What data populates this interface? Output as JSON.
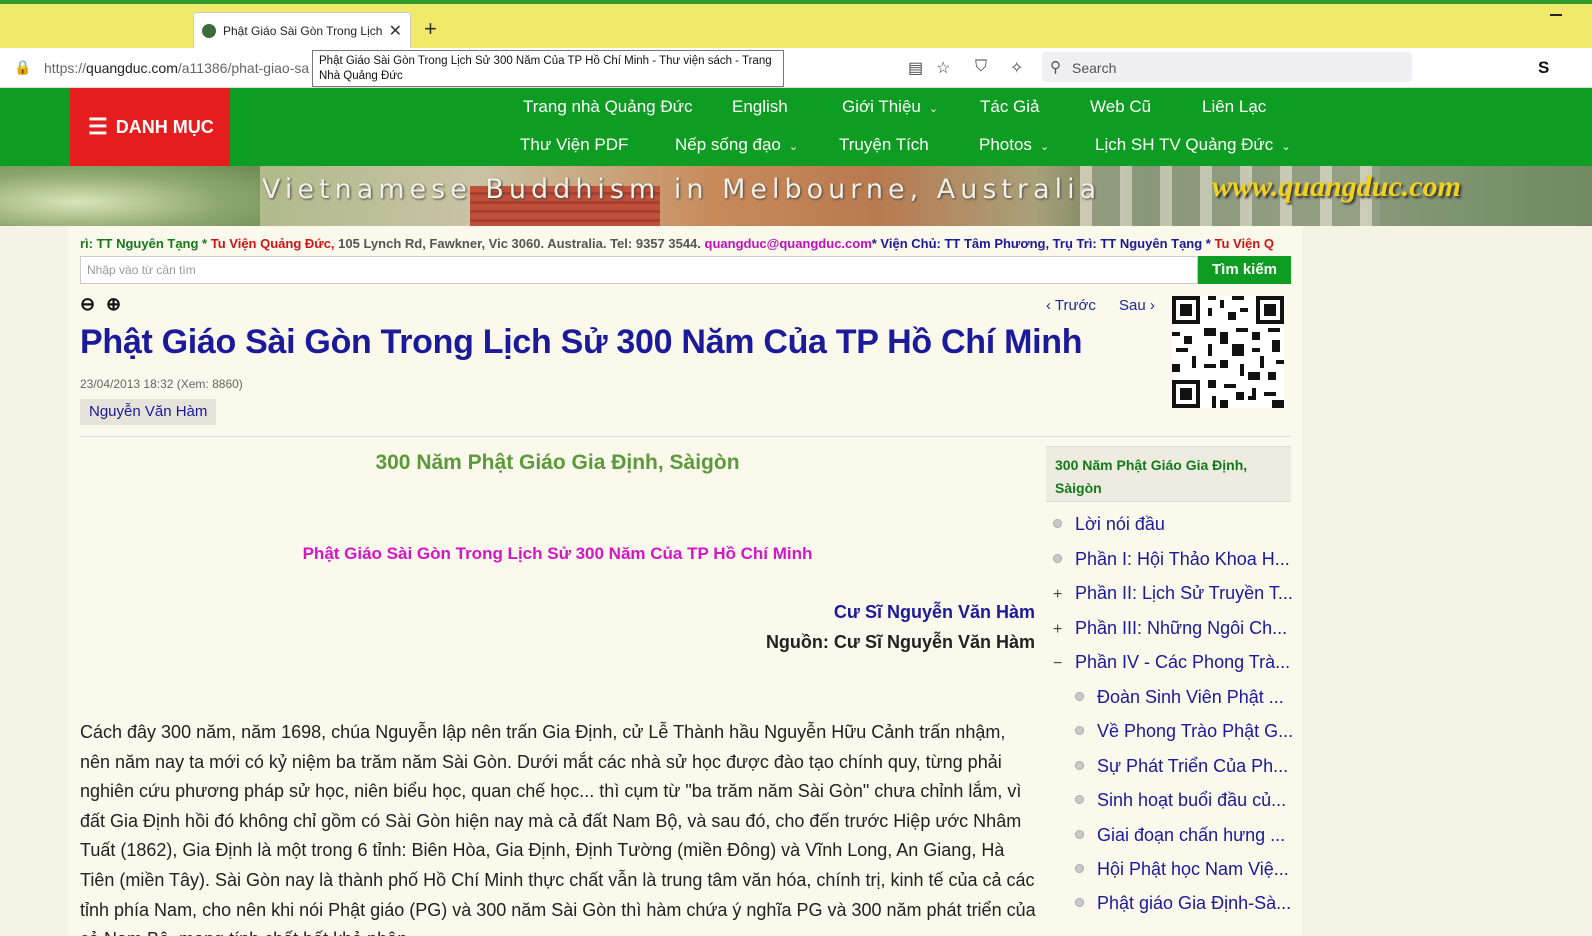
{
  "browser": {
    "tab_title": "Phật Giáo Sài Gòn Trong Lịch S",
    "url_prefix": "https://",
    "url_domain": "quangduc.com",
    "url_path": "/a11386/phat-giao-sa",
    "tooltip": "Phật Giáo Sài Gòn Trong Lịch Sử 300 Năm Của TP Hồ Chí Minh - Thư viện sách - Trang Nhà Quảng Đức",
    "search_placeholder": "Search",
    "new_tab": "+",
    "close_tab": "✕"
  },
  "header": {
    "danh_muc": "DANH MỤC",
    "menu_row1": [
      "Trang nhà Quảng Đức",
      "English",
      "Giới Thiệu",
      "Tác Giả",
      "Web Cũ",
      "Liên Lạc"
    ],
    "menu_row2": [
      "Thư Viện PDF",
      "Nếp sống đạo",
      "Truyện Tích",
      "Photos",
      "Lịch SH TV Quảng Đức"
    ],
    "banner_text": "Vietnamese Buddhism in Melbourne, Australia",
    "banner_url": "www.quangduc.com"
  },
  "ticker": {
    "t1": "rì: TT Nguyên Tạng *",
    "t2": "Tu Viện Quảng Đức,",
    "t3": "105 Lynch Rd, Fawkner, Vic 3060. Australia. Tel: 9357 3544.",
    "t4": "quangduc@quangduc.com",
    "t5": "* Viện Chủ: TT Tâm Phương, Trụ Trì: TT Nguyên Tạng *",
    "t6": "Tu Viện Q"
  },
  "site_search": {
    "placeholder": "Nhập vào từ cần tìm",
    "button": "Tìm kiếm"
  },
  "nav": {
    "zoom_out": "⊖",
    "zoom_in": "⊕",
    "prev": "Trước",
    "next": "Sau"
  },
  "article": {
    "title": "Phật Giáo Sài Gòn Trong Lịch Sử 300 Năm Của TP Hồ Chí Minh",
    "meta": "23/04/2013 18:32 (Xem: 8860)",
    "author_tag": "Nguyễn Văn Hàm",
    "sub1": "300 Năm Phật Giáo Gia Định, Sàigòn",
    "sub2": "Phật Giáo Sài Gòn Trong Lịch Sử 300 Năm Của TP Hồ Chí Minh",
    "byline1": "Cư Sĩ Nguyễn Văn Hàm",
    "byline2": "Nguồn: Cư Sĩ Nguyễn Văn Hàm",
    "body": "Cách đây 300 năm, năm 1698, chúa Nguyễn lập nên trấn Gia Định, cử Lễ Thành hầu Nguyễn Hữu Cảnh trấn nhậm, nên năm nay ta mới có kỷ niệm ba trăm năm Sài Gòn. Dưới mắt các nhà sử học được đào tạo chính quy, từng phải nghiên cứu phương pháp sử học, niên biểu học, quan chế học... thì cụm từ \"ba trăm năm Sài Gòn\" chưa chỉnh lắm, vì đất Gia Định hồi đó không chỉ gồm có Sài Gòn hiện nay mà cả đất Nam Bộ, và sau đó, cho đến trước Hiệp ước Nhâm Tuất (1862), Gia Định là một trong 6 tỉnh: Biên Hòa, Gia Định, Định Tường (miền Đông) và Vĩnh Long, An Giang, Hà Tiên (miền Tây). Sài Gòn nay là thành phố Hồ Chí Minh thực chất vẫn là trung tâm văn hóa, chính trị, kinh tế của cả các tỉnh phía Nam, cho nên khi nói Phật giáo (PG) và 300 năm Sài Gòn thì hàm chứa ý nghĩa PG và 300 năm phát triển của cả Nam Bộ, mang tính chất bất khả phân"
  },
  "sidebar": {
    "heading": "300 Năm Phật Giáo Gia Định, Sàigòn",
    "items": [
      {
        "label": "Lời nói đầu",
        "sign": ""
      },
      {
        "label": "Phần I: Hội Thảo Khoa H...",
        "sign": ""
      },
      {
        "label": "Phần II: Lịch Sử Truyền T...",
        "sign": "+"
      },
      {
        "label": "Phần III: Những Ngôi Ch...",
        "sign": "+"
      },
      {
        "label": "Phần IV - Các Phong Trà...",
        "sign": "−"
      }
    ],
    "subitems": [
      "Đoàn Sinh Viên Phật ...",
      "Về Phong Trào Phật G...",
      "Sự Phát Triển Của Ph...",
      "Sinh hoạt buổi đầu củ...",
      "Giai đoạn chấn hưng ...",
      "Hội Phật học Nam Việ...",
      "Phật giáo Gia Định-Sà..."
    ]
  },
  "colors": {
    "site_green": "#0d9d22",
    "danh_muc_red": "#e61d1d",
    "title_blue": "#1a1a9a",
    "sub_green": "#5b9a3a",
    "sub_magenta": "#d416c8",
    "tabstrip_yellow": "#f0e96a"
  }
}
